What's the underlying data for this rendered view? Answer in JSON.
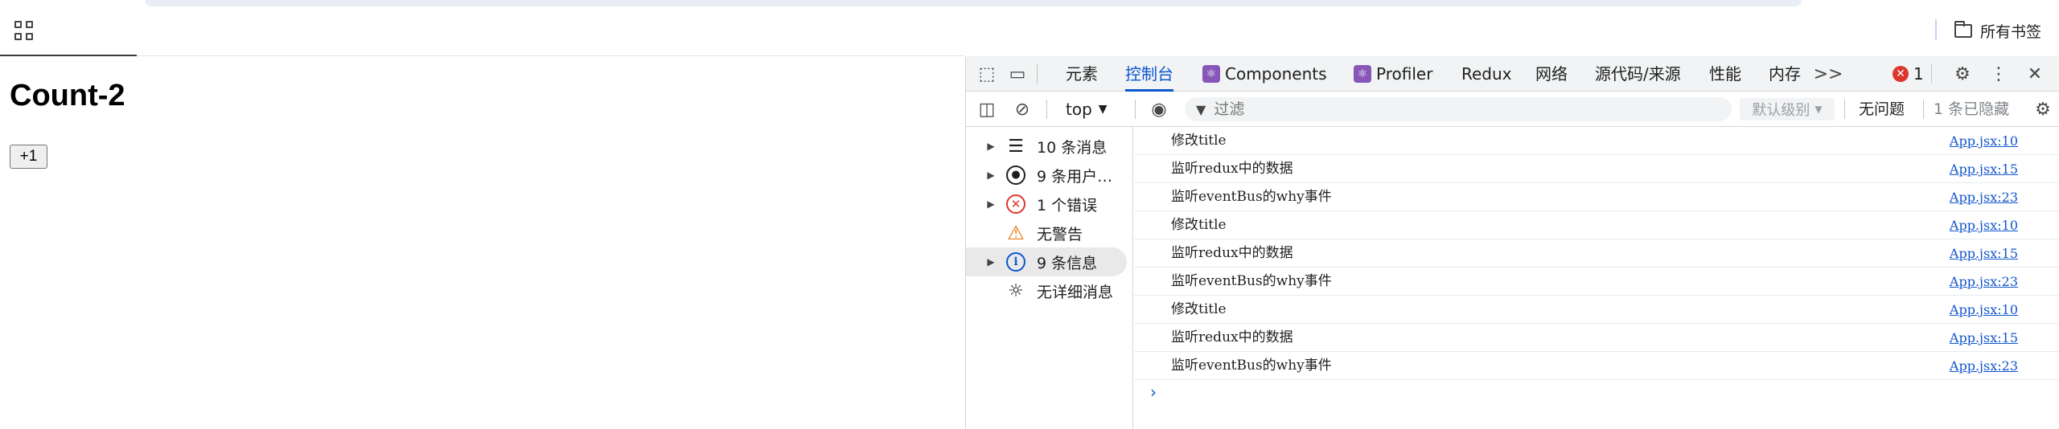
{
  "chrome": {
    "bookmarks_label": "所有书签"
  },
  "page": {
    "title": "Count-2",
    "button_label": "+1"
  },
  "devtools": {
    "tabs": [
      "元素",
      "控制台",
      "Components",
      "Profiler",
      "Redux",
      "网络",
      "源代码/来源",
      "性能",
      "内存"
    ],
    "more_tabs": ">>",
    "error_count": "1",
    "context": "top",
    "filter_placeholder": "过滤",
    "level": "默认级别",
    "issues": "无问题",
    "hidden": "1 条已隐藏",
    "sidebar": [
      {
        "label": "10 条消息",
        "icon": "list-icon"
      },
      {
        "label": "9 条用户…",
        "icon": "user-icon"
      },
      {
        "label": "1 个错误",
        "icon": "error-icon"
      },
      {
        "label": "无警告",
        "icon": "warning-icon"
      },
      {
        "label": "9 条信息",
        "icon": "info-icon"
      },
      {
        "label": "无详细消息",
        "icon": "bug-icon"
      }
    ],
    "logs": [
      {
        "msg": "修改title",
        "src": "App.jsx:10"
      },
      {
        "msg": "监听redux中的数据",
        "src": "App.jsx:15"
      },
      {
        "msg": "监听eventBus的why事件",
        "src": "App.jsx:23"
      },
      {
        "msg": "修改title",
        "src": "App.jsx:10"
      },
      {
        "msg": "监听redux中的数据",
        "src": "App.jsx:15"
      },
      {
        "msg": "监听eventBus的why事件",
        "src": "App.jsx:23"
      },
      {
        "msg": "修改title",
        "src": "App.jsx:10"
      },
      {
        "msg": "监听redux中的数据",
        "src": "App.jsx:15"
      },
      {
        "msg": "监听eventBus的why事件",
        "src": "App.jsx:23"
      }
    ],
    "prompt": "›"
  }
}
